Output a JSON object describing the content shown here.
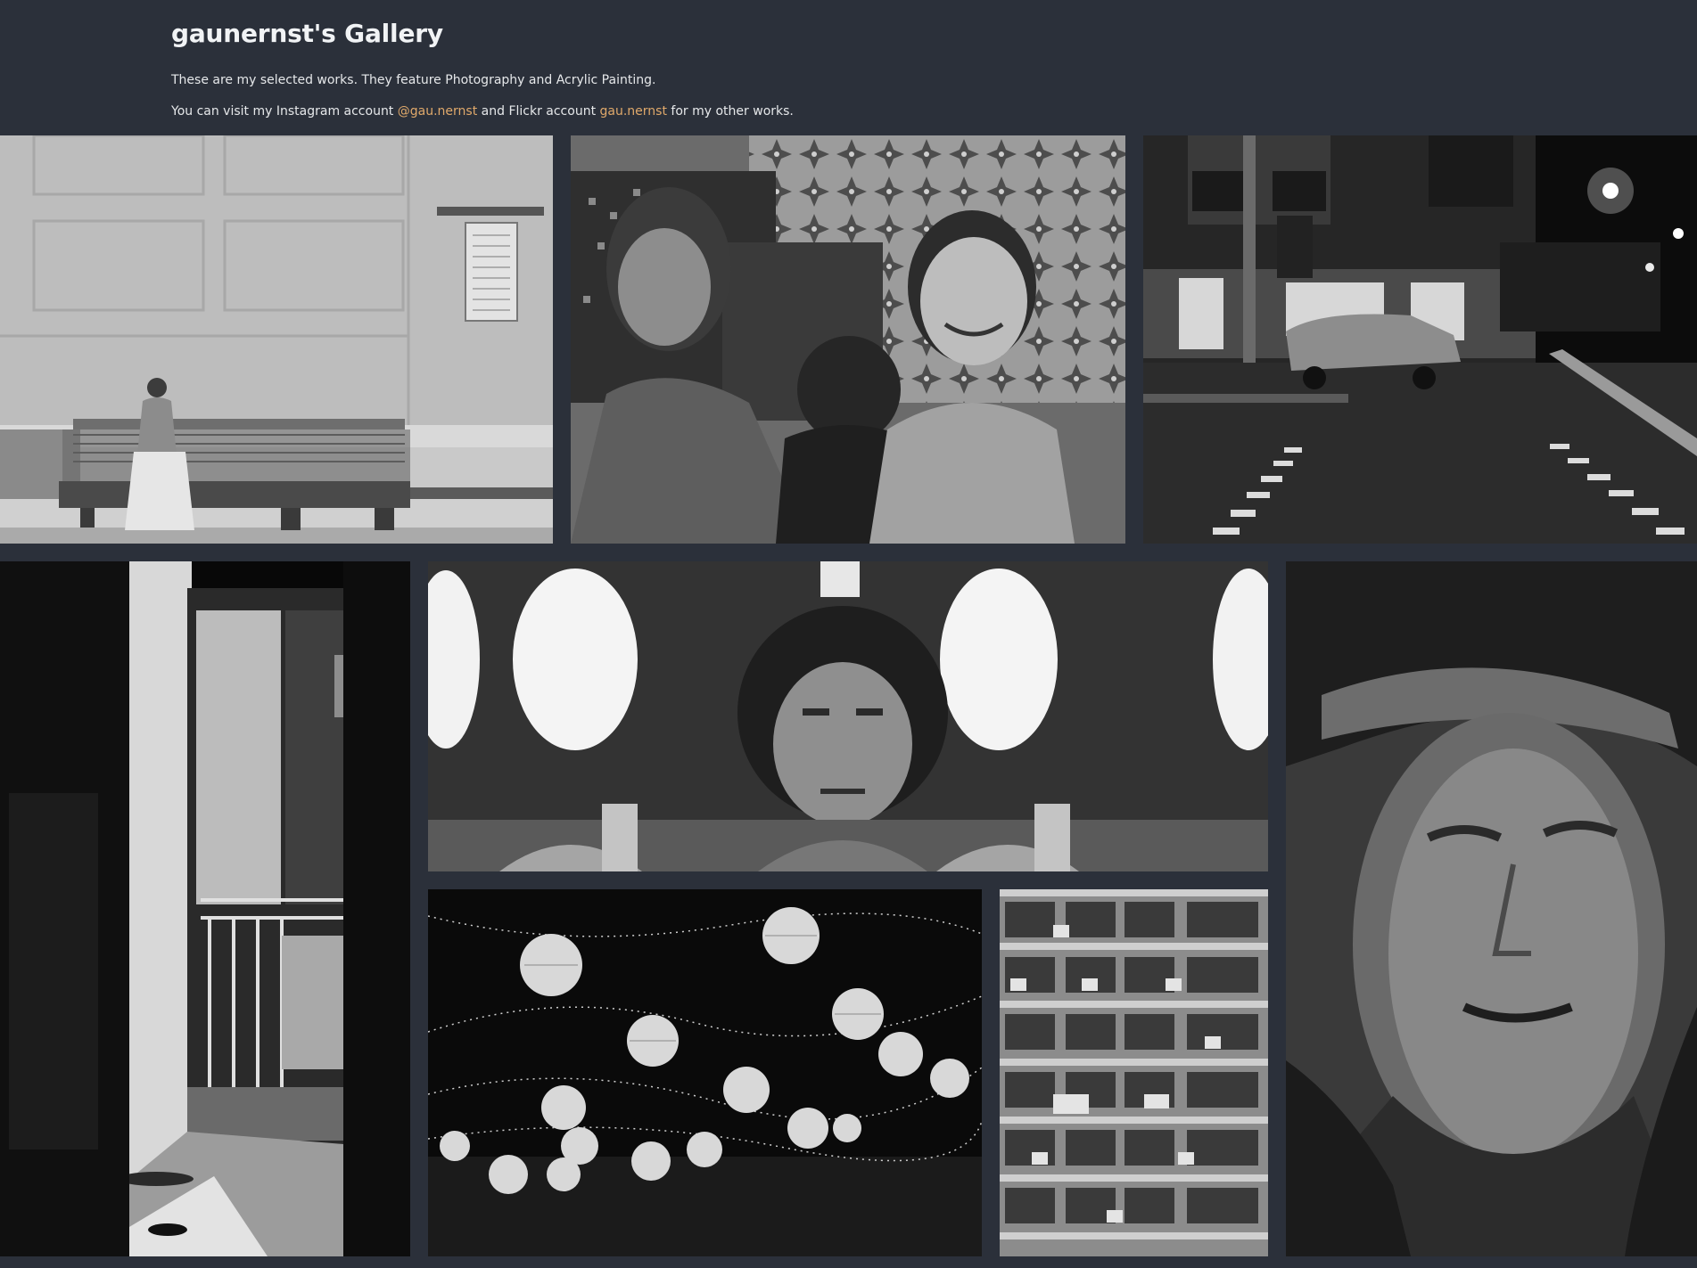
{
  "header": {
    "title": "gaunernst's Gallery",
    "intro": "These are my selected works. They feature Photography and Acrylic Painting.",
    "links_prefix": "You can visit my Instagram account ",
    "instagram_link": "@gau.nernst",
    "links_middle": " and Flickr account ",
    "flickr_link": "gau.nernst",
    "links_suffix": " for my other works."
  },
  "colors": {
    "background": "#2b303a",
    "accent": "#e0a96b",
    "text": "#e6e8ea"
  },
  "gallery": {
    "items": [
      {
        "name": "woman-on-bench-photo",
        "kind": "photograph"
      },
      {
        "name": "mural-man-and-boy-painting",
        "kind": "mural"
      },
      {
        "name": "night-street-crossing-photo",
        "kind": "photograph"
      },
      {
        "name": "doorway-light-photo",
        "kind": "photograph"
      },
      {
        "name": "mural-boy-portrait-painting",
        "kind": "mural"
      },
      {
        "name": "face-portrait-painting",
        "kind": "acrylic painting"
      },
      {
        "name": "paper-lanterns-photo",
        "kind": "photograph"
      },
      {
        "name": "apartment-block-photo",
        "kind": "photograph"
      }
    ]
  }
}
